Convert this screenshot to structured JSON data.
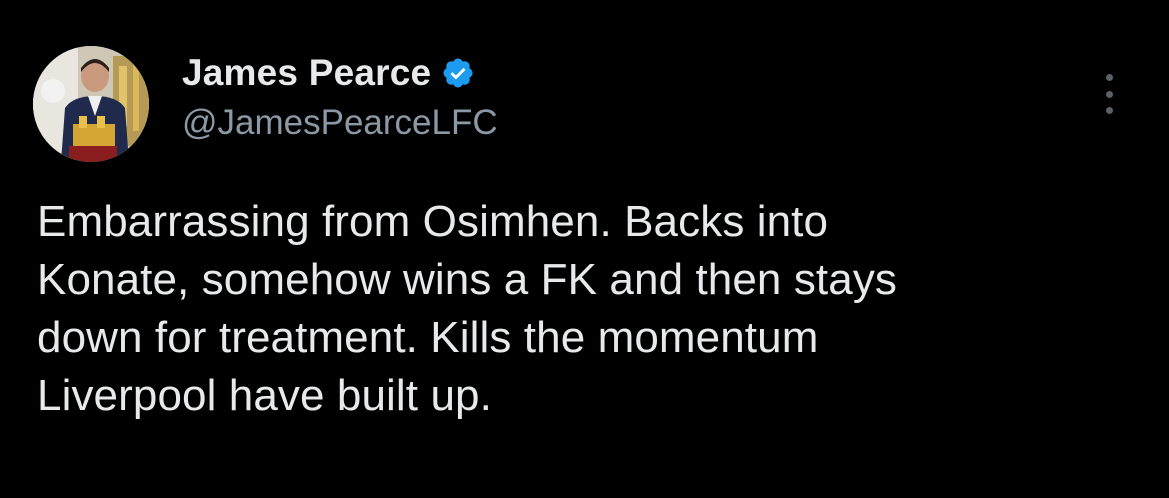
{
  "tweet": {
    "author": {
      "display_name": "James Pearce",
      "handle": "@JamesPearceLFC",
      "verified": true,
      "verified_badge_color": "#1d9bf0"
    },
    "text_lines": [
      "Embarrassing from Osimhen. Backs into",
      "Konate, somehow wins a FK and then stays",
      "down for treatment. Kills the momentum",
      "Liverpool have built up."
    ],
    "icons": {
      "more": "more-options-icon",
      "verified": "verified-badge-icon"
    }
  },
  "colors": {
    "background": "#000000",
    "text_primary": "#e7e9ea",
    "text_secondary": "#8b98a5"
  }
}
